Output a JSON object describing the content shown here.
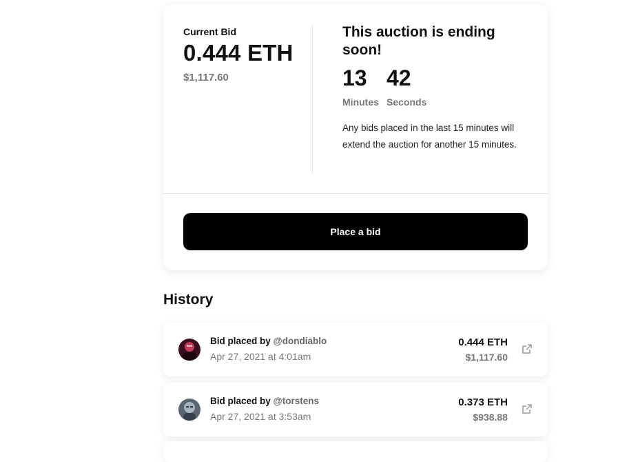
{
  "auction_card": {
    "current_bid_label": "Current Bid",
    "current_bid_eth": "0.444 ETH",
    "current_bid_usd": "$1,117.60",
    "ending_title": "This auction is ending soon!",
    "timer": {
      "minutes_value": "13",
      "minutes_label": "Minutes",
      "seconds_value": "42",
      "seconds_label": "Seconds"
    },
    "note": "Any bids placed in the last 15 minutes will extend the auction for another 15 minutes.",
    "place_bid_label": "Place a bid"
  },
  "history": {
    "title": "History",
    "items": [
      {
        "prefix": "Bid placed by",
        "user": "@dondiablo",
        "date": "Apr 27, 2021 at 4:01am",
        "eth": "0.444 ETH",
        "usd": "$1,117.60",
        "avatar_colors": [
          "#3a0d1f",
          "#c23a5a"
        ]
      },
      {
        "prefix": "Bid placed by",
        "user": "@torstens",
        "date": "Apr 27, 2021 at 3:53am",
        "eth": "0.373 ETH",
        "usd": "$938.88",
        "avatar_colors": [
          "#5a6570",
          "#a8b4bd"
        ]
      }
    ]
  },
  "icons": {
    "external_link": "external-link-icon"
  },
  "colors": {
    "button_bg": "#000000",
    "button_text": "#ffffff",
    "muted_text": "#777777"
  }
}
